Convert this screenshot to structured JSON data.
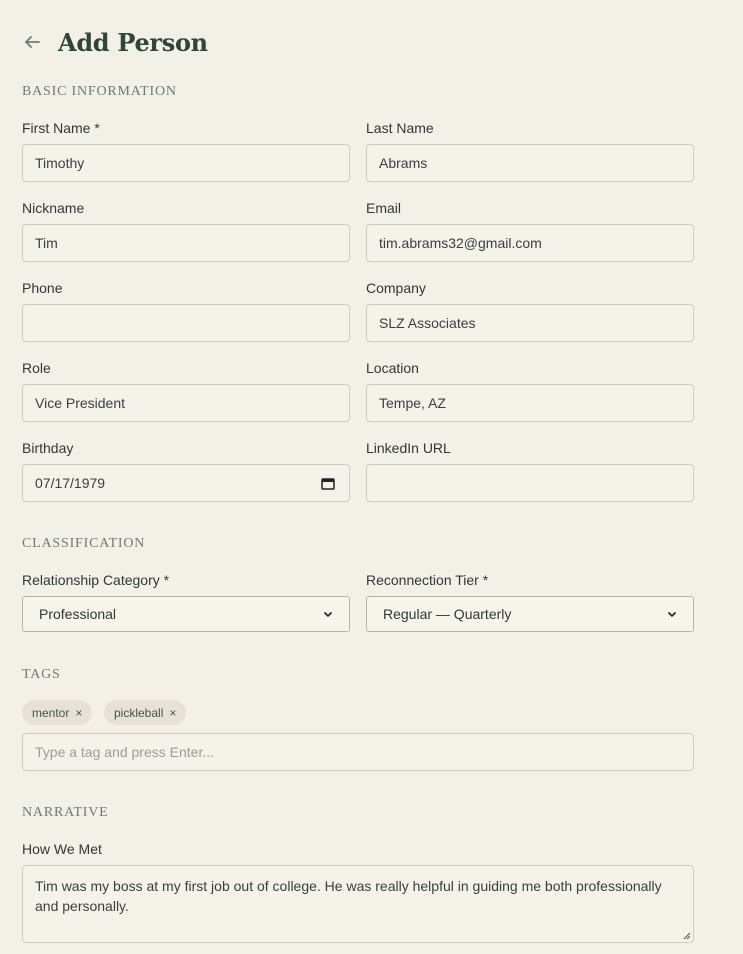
{
  "header": {
    "title": "Add Person",
    "back_icon": "arrow-left-icon"
  },
  "sections": {
    "basic": "BASIC INFORMATION",
    "classification": "CLASSIFICATION",
    "tags": "TAGS",
    "narrative": "NARRATIVE"
  },
  "fields": {
    "first_name": {
      "label": "First Name *",
      "value": "Timothy"
    },
    "last_name": {
      "label": "Last Name",
      "value": "Abrams"
    },
    "nickname": {
      "label": "Nickname",
      "value": "Tim"
    },
    "email": {
      "label": "Email",
      "value": "tim.abrams32@gmail.com"
    },
    "phone": {
      "label": "Phone",
      "value": ""
    },
    "company": {
      "label": "Company",
      "value": "SLZ Associates"
    },
    "role": {
      "label": "Role",
      "value": "Vice President"
    },
    "location": {
      "label": "Location",
      "value": "Tempe, AZ"
    },
    "birthday": {
      "label": "Birthday",
      "value": "07/17/1979"
    },
    "linkedin": {
      "label": "LinkedIn URL",
      "value": ""
    }
  },
  "classification": {
    "relationship_category": {
      "label": "Relationship Category *",
      "selected": "Professional"
    },
    "reconnection_tier": {
      "label": "Reconnection Tier *",
      "selected": "Regular — Quarterly"
    }
  },
  "tags": {
    "items": [
      "mentor",
      "pickleball"
    ],
    "remove_glyph": "×",
    "input_placeholder": "Type a tag and press Enter..."
  },
  "narrative": {
    "how_we_met": {
      "label": "How We Met",
      "value": "Tim was my boss at my first job out of college. He was really helpful in guiding me both professionally and personally."
    }
  },
  "colors": {
    "background": "#f3f0e8",
    "title": "#2e4538",
    "section": "#6b7d71",
    "border": "#cfcbc0",
    "tag_bg": "#e6e2d8"
  }
}
